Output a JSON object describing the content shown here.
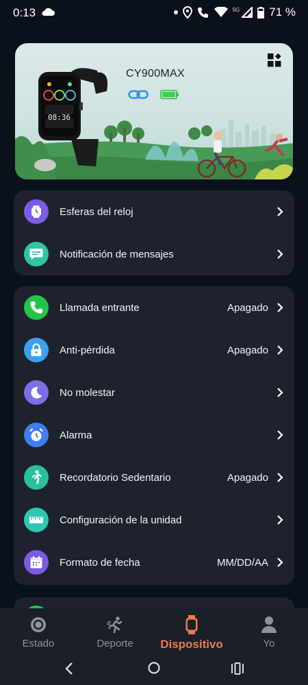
{
  "status": {
    "time": "0:13",
    "network": "5G",
    "battery": "71 %"
  },
  "device": {
    "name": "CY900MAX",
    "watch_time": "08:36"
  },
  "card1": [
    {
      "label": "Esferas del reloj",
      "value": "",
      "icon": "watch-face-icon",
      "color": "#7c5ce6"
    },
    {
      "label": "Notificación de mensajes",
      "value": "",
      "icon": "message-icon",
      "color": "#2ec7a5"
    }
  ],
  "card2": [
    {
      "label": "Llamada entrante",
      "value": "Apagado",
      "icon": "phone-icon",
      "color": "#25c24a"
    },
    {
      "label": "Anti-pérdida",
      "value": "Apagado",
      "icon": "lock-icon",
      "color": "#3aa0f2"
    },
    {
      "label": "No molestar",
      "value": "",
      "icon": "moon-icon",
      "color": "#7c6de8"
    },
    {
      "label": "Alarma",
      "value": "",
      "icon": "alarm-icon",
      "color": "#3c7ff0"
    },
    {
      "label": "Recordatorio Sedentario",
      "value": "Apagado",
      "icon": "walking-icon",
      "color": "#27c29b"
    },
    {
      "label": "Configuración de la unidad",
      "value": "",
      "icon": "ruler-icon",
      "color": "#2ec7b0"
    },
    {
      "label": "Formato de fecha",
      "value": "MM/DD/AA",
      "icon": "calendar-icon",
      "color": "#7b5ae6"
    }
  ],
  "nav": {
    "items": [
      {
        "label": "Estado",
        "icon": "status-icon"
      },
      {
        "label": "Deporte",
        "icon": "running-icon"
      },
      {
        "label": "Dispositivo",
        "icon": "watch-icon"
      },
      {
        "label": "Yo",
        "icon": "person-icon"
      }
    ],
    "active": "Dispositivo"
  },
  "colors": {
    "background": "#0b111a",
    "card": "#1d222d",
    "accent": "#f07a4a",
    "nav_inactive": "#8d929c"
  }
}
